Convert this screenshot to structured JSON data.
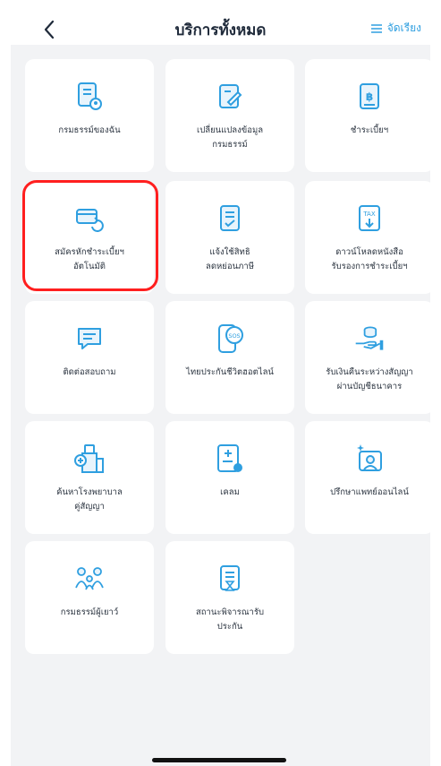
{
  "header": {
    "title": "บริการทั้งหมด",
    "sort_label": "จัดเรียง",
    "accent_color": "#2f9fe0"
  },
  "tiles": [
    {
      "label": "กรมธรรม์ของฉัน",
      "icon": "policy-document-icon"
    },
    {
      "label": "เปลี่ยนแปลงข้อมูล\nกรมธรรม์",
      "icon": "edit-document-icon"
    },
    {
      "label": "ชำระเบี้ยฯ",
      "icon": "baht-payment-icon"
    },
    {
      "label": "สมัครหักชำระเบี้ยฯ\nอัตโนมัติ",
      "icon": "auto-debit-card-icon"
    },
    {
      "label": "แจ้งใช้สิทธิ\nลดหย่อนภาษี",
      "icon": "tax-checklist-icon"
    },
    {
      "label": "ดาวน์โหลดหนังสือ\nรับรองการชำระเบี้ยฯ",
      "icon": "tax-download-icon"
    },
    {
      "label": "ติดต่อสอบถาม",
      "icon": "chat-bubble-icon"
    },
    {
      "label": "ไทยประกันชีวิตฮอตไลน์",
      "icon": "sos-phone-icon"
    },
    {
      "label": "รับเงินคืนระหว่างสัญญา\nผ่านบัญชีธนาคาร",
      "icon": "hand-coins-icon"
    },
    {
      "label": "ค้นหาโรงพยาบาล\nคู่สัญญา",
      "icon": "hospital-icon"
    },
    {
      "label": "เคลม",
      "icon": "claim-document-icon"
    },
    {
      "label": "ปรึกษาแพทย์ออนไลน์",
      "icon": "doctor-online-icon"
    },
    {
      "label": "กรมธรรม์ผู้เยาว์",
      "icon": "family-icon"
    },
    {
      "label": "สถานะพิจารณารับ\nประกัน",
      "icon": "hourglass-document-icon"
    }
  ]
}
